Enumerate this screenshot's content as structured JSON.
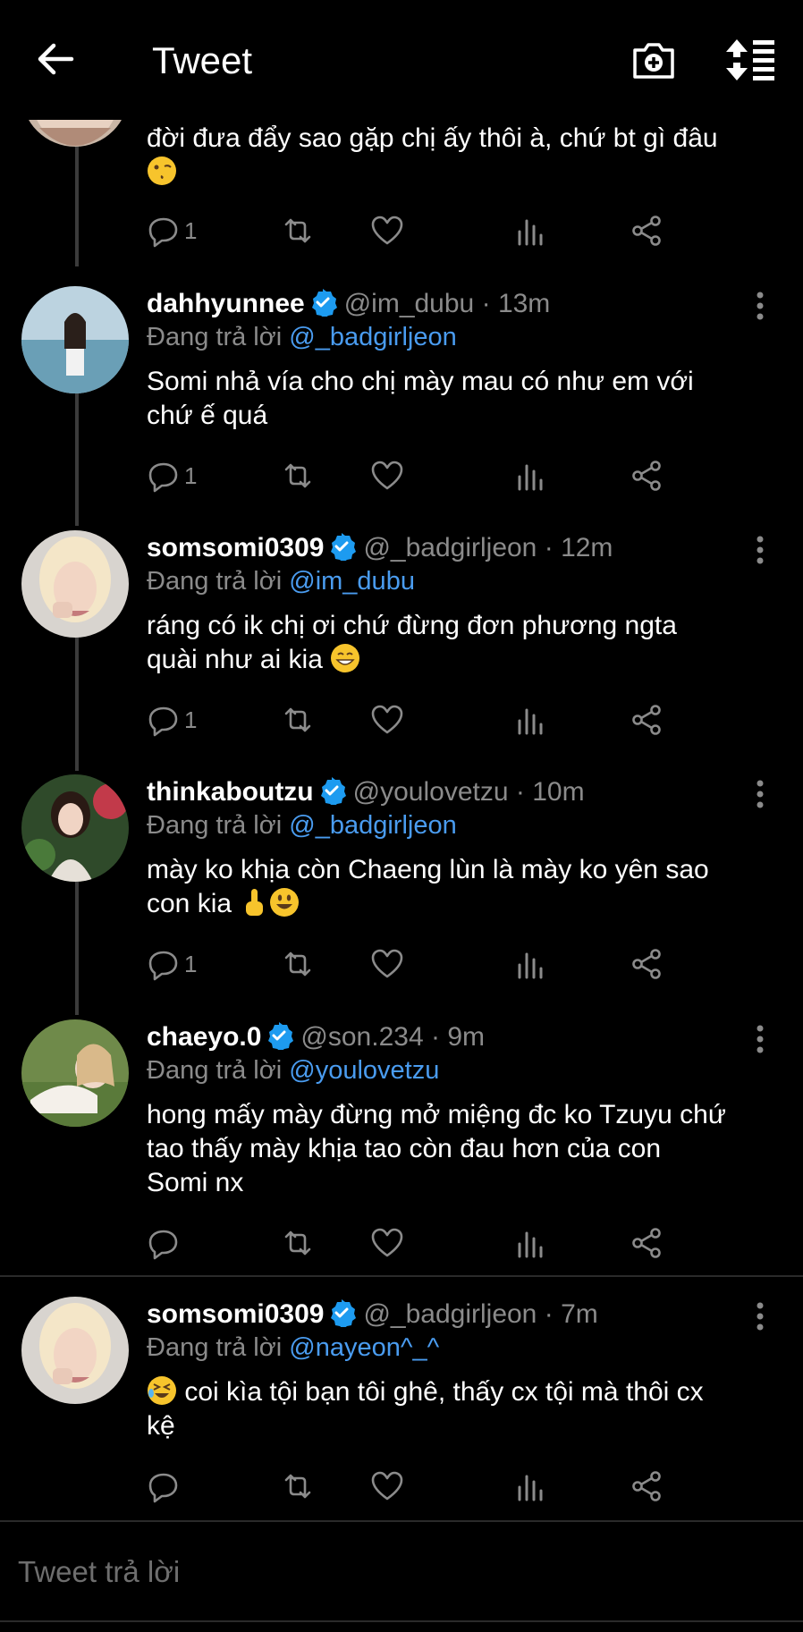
{
  "header": {
    "title": "Tweet",
    "back_icon": "arrow-left-icon",
    "camera_icon": "camera-plus-icon",
    "sort_icon": "sort-icon"
  },
  "colors": {
    "background": "#000000",
    "text": "#ffffff",
    "muted": "#8b8b8b",
    "accent": "#4a9cf0",
    "verified": "#1d9bf0"
  },
  "top_tweet": {
    "text": "đời đưa đẩy sao gặp chị ấy thôi à, chứ bt gì đâu",
    "reply_count": "1"
  },
  "tweets": [
    {
      "name": "dahhyunnee",
      "handle": "@im_dubu",
      "sep": "·",
      "time": "13m",
      "reply_prefix": "Đang trả lời",
      "reply_to": "@_badgirljeon",
      "text1": "Somi nhả vía cho chị mày mau có như em với",
      "text2": "chứ ế quá",
      "reply_count": "1"
    },
    {
      "name": "somsomi0309",
      "handle": "@_badgirljeon",
      "sep": "·",
      "time": "12m",
      "reply_prefix": "Đang trả lời",
      "reply_to": "@im_dubu",
      "text1": "ráng có ik chị ơi chứ đừng đơn phương ngta",
      "text2": "quài như ai kia",
      "reply_count": "1"
    },
    {
      "name": "thinkaboutzu",
      "handle": "@youlovetzu",
      "sep": "·",
      "time": "10m",
      "reply_prefix": "Đang trả lời",
      "reply_to": "@_badgirljeon",
      "text1": "mày ko khịa còn Chaeng lùn là mày ko yên sao",
      "text2": "con kia",
      "reply_count": "1"
    },
    {
      "name": "chaeyo.0",
      "handle": "@son.234",
      "sep": "·",
      "time": "9m",
      "reply_prefix": "Đang trả lời",
      "reply_to": "@youlovetzu",
      "text1": "hong mấy mày đừng mở miệng đc ko Tzuyu chứ",
      "text2": "tao thấy mày khịa tao còn đau hơn của con",
      "text3": "Somi nx",
      "reply_count": ""
    },
    {
      "name": "somsomi0309",
      "handle": "@_badgirljeon",
      "sep": "·",
      "time": "7m",
      "reply_prefix": "Đang trả lời",
      "reply_to": "@nayeon^_^",
      "text1": "coi kìa tội bạn tôi ghê, thấy cx tội mà thôi cx",
      "text2": "kệ",
      "reply_count": ""
    }
  ],
  "composer": {
    "placeholder": "Tweet trả lời"
  }
}
